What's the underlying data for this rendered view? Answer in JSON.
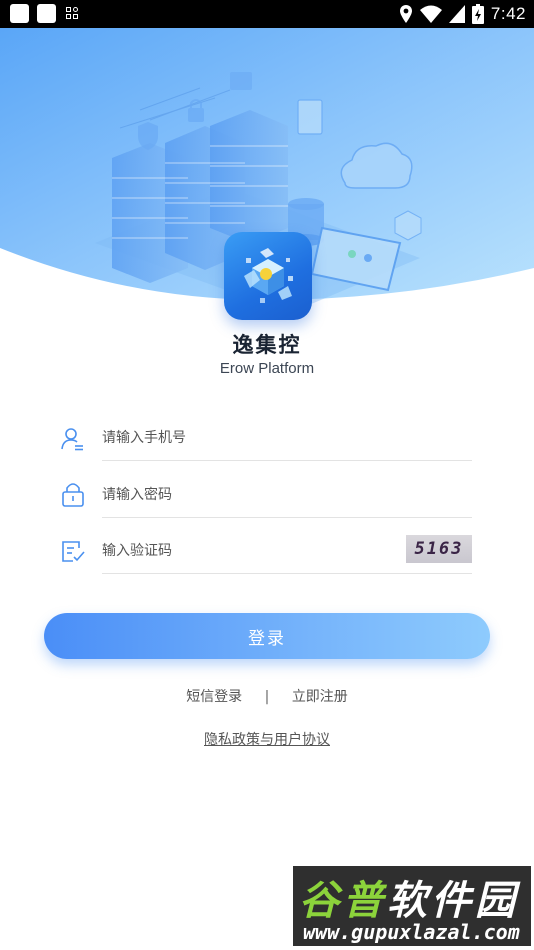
{
  "status_bar": {
    "time": "7:42"
  },
  "app": {
    "name": "逸集控",
    "subtitle": "Erow Platform"
  },
  "form": {
    "phone_placeholder": "请输入手机号",
    "password_placeholder": "请输入密码",
    "captcha_placeholder": "输入验证码",
    "captcha_code": "5163"
  },
  "login_button": "登录",
  "links": {
    "sms_login": "短信登录",
    "separator": "|",
    "register": "立即注册"
  },
  "policy": "隐私政策与用户协议",
  "watermark": {
    "title_part1": "谷普",
    "title_part2": "软件园",
    "url": "www.gupuxlazal.com"
  },
  "colors": {
    "primary": "#4a8ef7",
    "hero_light": "#a9d8fb",
    "text_dark": "#1a2433"
  },
  "icons": [
    "user-icon",
    "lock-icon",
    "verify-code-icon",
    "location-icon",
    "wifi-icon",
    "signal-icon",
    "battery-icon"
  ]
}
